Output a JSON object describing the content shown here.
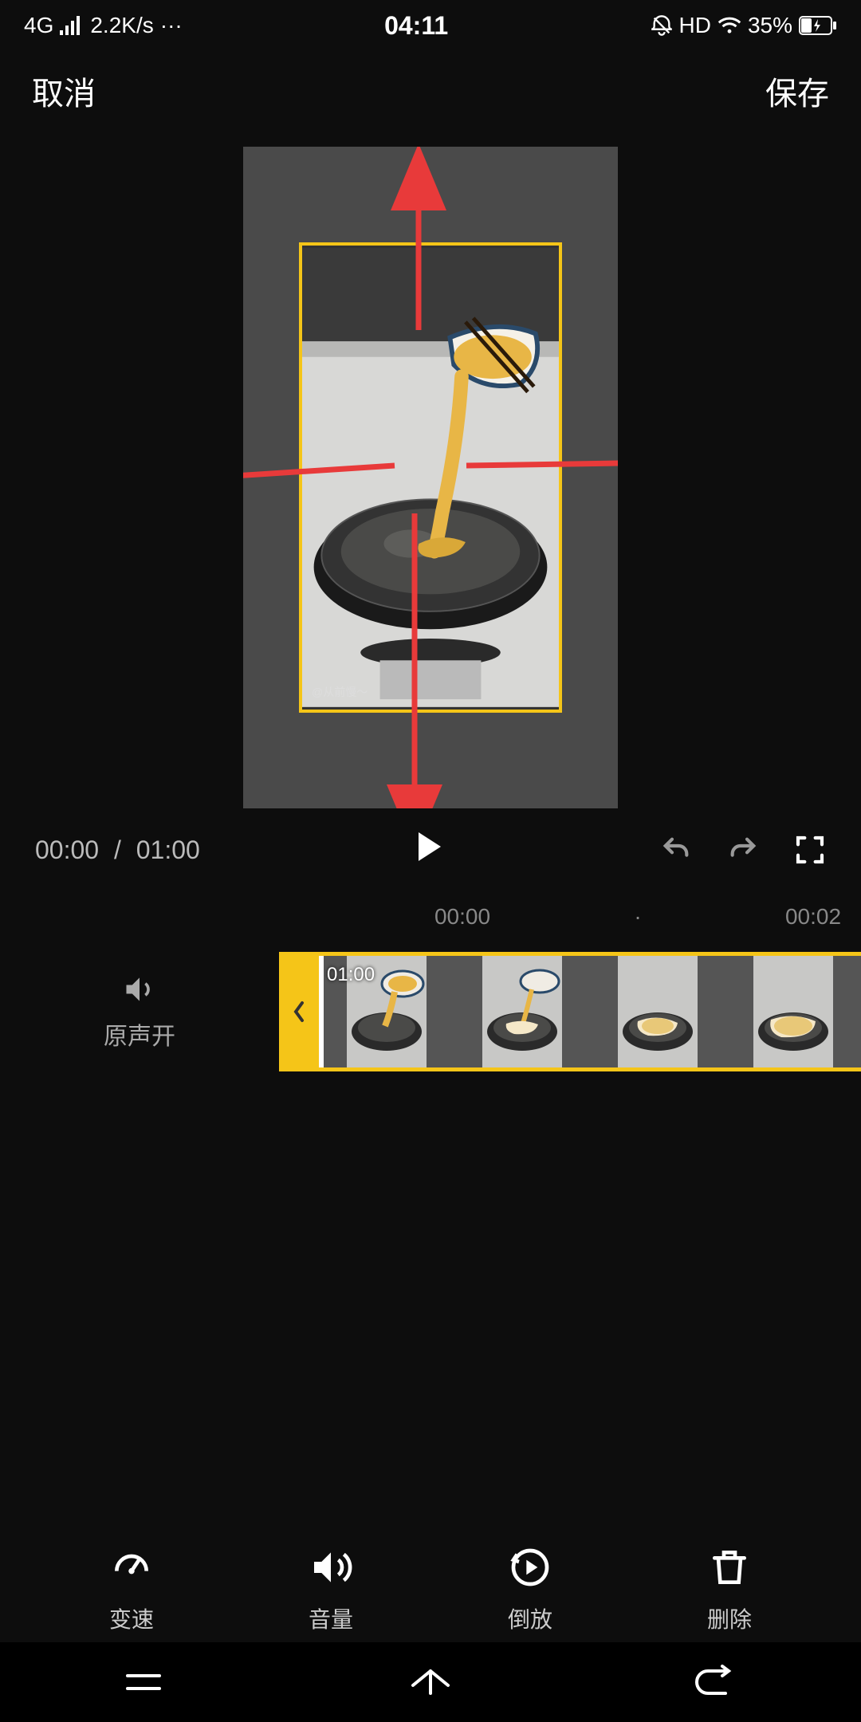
{
  "status": {
    "network": "4G",
    "speed": "2.2K/s",
    "more": "···",
    "time": "04:11",
    "hd": "HD",
    "battery_pct": "35%"
  },
  "top": {
    "cancel": "取消",
    "save": "保存"
  },
  "preview": {
    "watermark": "@从前慢～"
  },
  "playback": {
    "current": "00:00",
    "total": "01:00",
    "sep": "/"
  },
  "ruler": {
    "marks": [
      "00:00",
      "·",
      "00:02",
      "·"
    ]
  },
  "timeline": {
    "sound_label": "原声开",
    "clip_duration": "01:00"
  },
  "tools": {
    "speed": "变速",
    "volume": "音量",
    "reverse": "倒放",
    "delete": "删除"
  }
}
